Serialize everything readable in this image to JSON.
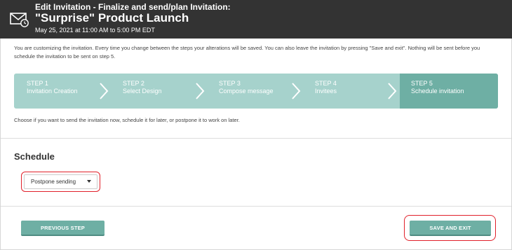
{
  "header": {
    "subtitle": "Edit Invitation - Finalize and send/plan Invitation:",
    "title": "\"Surprise\" Product Launch",
    "datetime": "May 25, 2021 at 11:00 AM to 5:00 PM EDT",
    "icon": "mail-clock-icon"
  },
  "intro": "You are customizing the invitation. Every time you change between the steps your alterations will be saved. You can also leave the invitation by pressing \"Save and exit\". Nothing will be sent before you schedule the invitation to be sent on step 5.",
  "steps": [
    {
      "num": "STEP 1",
      "label": "Invitation Creation"
    },
    {
      "num": "STEP 2",
      "label": "Select Design"
    },
    {
      "num": "STEP 3",
      "label": "Compose message"
    },
    {
      "num": "STEP 4",
      "label": "Invitees"
    },
    {
      "num": "STEP 5",
      "label": "Schedule invitation"
    }
  ],
  "active_step": 5,
  "choose_text": "Choose if you want to send the invitation now, schedule it for later, or postpone it to work on later.",
  "schedule": {
    "title": "Schedule",
    "selected": "Postpone sending"
  },
  "buttons": {
    "previous": "PREVIOUS STEP",
    "save_exit": "SAVE AND EXIT"
  },
  "colors": {
    "header_bg": "#333333",
    "accent": "#6eafa4",
    "stepper_light": "#a6d2cc",
    "highlight": "#e1202a"
  }
}
